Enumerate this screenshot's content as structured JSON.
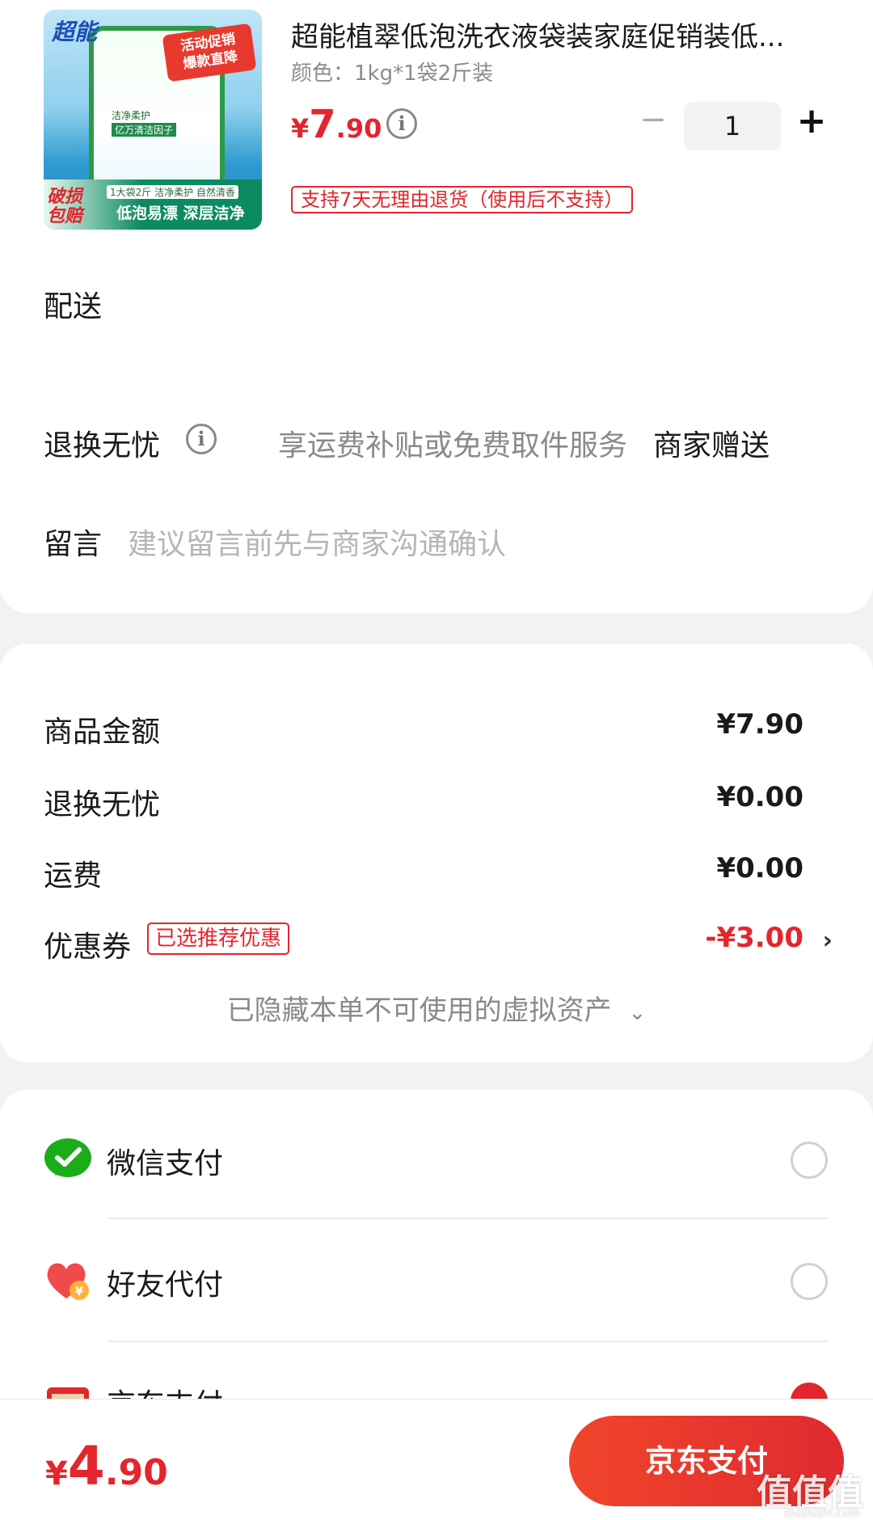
{
  "product": {
    "title": "超能植翠低泡洗衣液袋装家庭促销装低...",
    "spec": "颜色：1kg*1袋2斤装",
    "price_currency": "¥",
    "price_int": "7",
    "price_dec": ".90",
    "quantity": "1",
    "return_tag": "支持7天无理由退货（使用后不支持）",
    "image": {
      "brand": "超能",
      "promo_line1": "活动促销",
      "promo_line2": "爆款直降",
      "line1": "洁净柔护",
      "line2": "亿万清洁因子",
      "badge": "破损包赔",
      "bar_sub": "1大袋2斤 洁净柔护 自然清香",
      "bar_text": "低泡易漂 深层洁净"
    }
  },
  "order": {
    "delivery_label": "配送",
    "return_worry_label": "退换无忧",
    "return_worry_desc": "享运费补贴或免费取件服务",
    "return_worry_provider": "商家赠送",
    "message_label": "留言",
    "message_placeholder": "建议留言前先与商家沟通确认"
  },
  "fees": {
    "goods_amount_label": "商品金额",
    "goods_amount_value": "¥7.90",
    "return_worry_label": "退换无忧",
    "return_worry_value": "¥0.00",
    "shipping_label": "运费",
    "shipping_value": "¥0.00",
    "coupon_label": "优惠券",
    "coupon_tag": "已选推荐优惠",
    "coupon_value": "-¥3.00",
    "hidden_assets": "已隐藏本单不可使用的虚拟资产"
  },
  "payment": {
    "methods": [
      {
        "label": "微信支付",
        "icon": "wechat-pay-icon",
        "selected": false
      },
      {
        "label": "好友代付",
        "icon": "friend-pay-icon",
        "selected": false
      },
      {
        "label": "京东支付",
        "icon": "jd-pay-icon",
        "selected": true
      }
    ]
  },
  "footer": {
    "total_currency": "¥",
    "total_int": "4",
    "total_dec": ".90",
    "pay_button": "京东支付",
    "watermark": "值值值",
    "watermark_url": "zhizhizhi.com"
  },
  "colors": {
    "accent": "#e3252d",
    "background": "#f2f2f2",
    "wechat_green": "#1aad19"
  }
}
